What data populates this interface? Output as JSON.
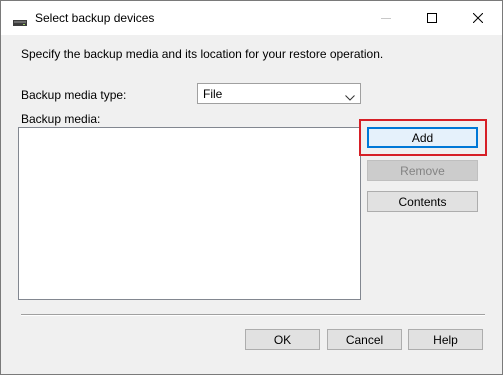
{
  "window": {
    "title": "Select backup devices",
    "controls": {
      "minimize_icon": "minimize-icon",
      "maximize_icon": "maximize-icon",
      "close_icon": "close-icon"
    }
  },
  "instructions": "Specify the backup media and its location for your restore operation.",
  "media_type": {
    "label": "Backup media type:",
    "selected": "File"
  },
  "media_list": {
    "label": "Backup media:",
    "items": []
  },
  "actions": {
    "add": "Add",
    "remove": "Remove",
    "contents": "Contents"
  },
  "footer": {
    "ok": "OK",
    "cancel": "Cancel",
    "help": "Help"
  },
  "colors": {
    "highlight": "#d61f26",
    "default_button_border": "#0078d7"
  }
}
